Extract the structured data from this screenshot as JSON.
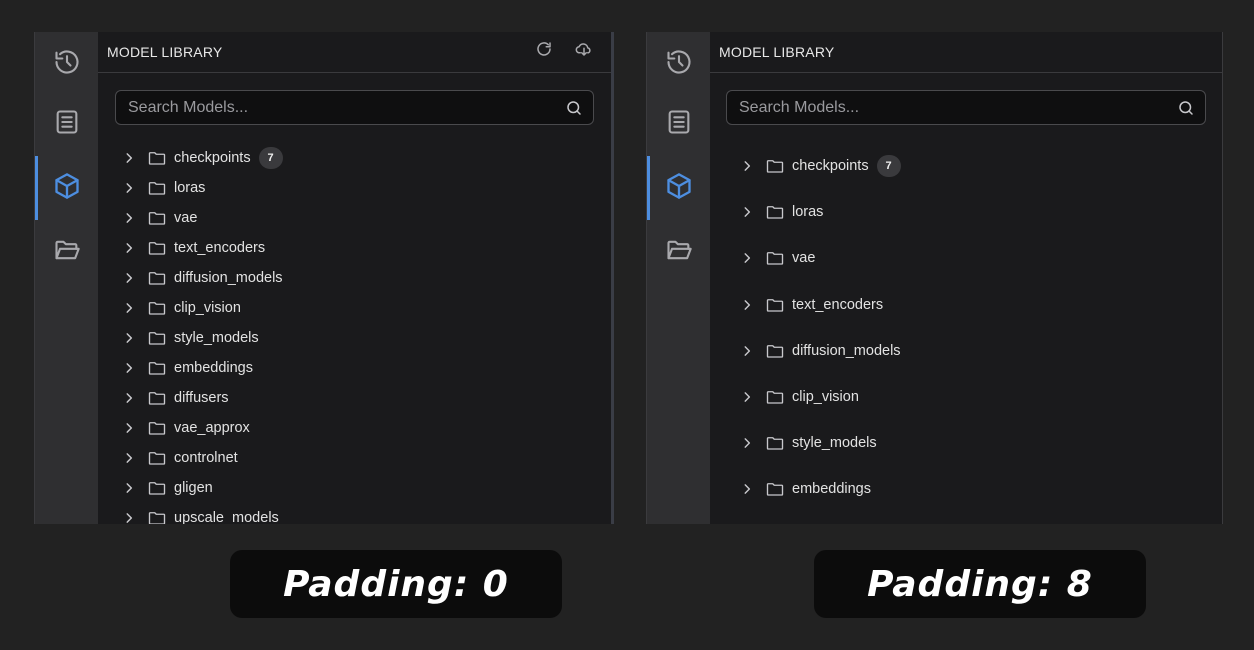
{
  "colors": {
    "accent": "#4d8ee0",
    "panel_bg": "#1a1a1c",
    "rail_bg": "#2f2f31",
    "page_bg": "#222222"
  },
  "rail_icons": [
    "history-icon",
    "book-icon",
    "cube-icon",
    "folder-open-icon"
  ],
  "left": {
    "header_title": "MODEL LIBRARY",
    "search_placeholder": "Search Models...",
    "items": [
      {
        "label": "checkpoints",
        "badge": "7"
      },
      {
        "label": "loras"
      },
      {
        "label": "vae"
      },
      {
        "label": "text_encoders"
      },
      {
        "label": "diffusion_models"
      },
      {
        "label": "clip_vision"
      },
      {
        "label": "style_models"
      },
      {
        "label": "embeddings"
      },
      {
        "label": "diffusers"
      },
      {
        "label": "vae_approx"
      },
      {
        "label": "controlnet"
      },
      {
        "label": "gligen"
      },
      {
        "label": "upscale_models"
      }
    ],
    "caption": "Padding: 0"
  },
  "right": {
    "header_title": "MODEL LIBRARY",
    "search_placeholder": "Search Models...",
    "items": [
      {
        "label": "checkpoints",
        "badge": "7"
      },
      {
        "label": "loras"
      },
      {
        "label": "vae"
      },
      {
        "label": "text_encoders"
      },
      {
        "label": "diffusion_models"
      },
      {
        "label": "clip_vision"
      },
      {
        "label": "style_models"
      },
      {
        "label": "embeddings"
      }
    ],
    "caption": "Padding: 8"
  }
}
